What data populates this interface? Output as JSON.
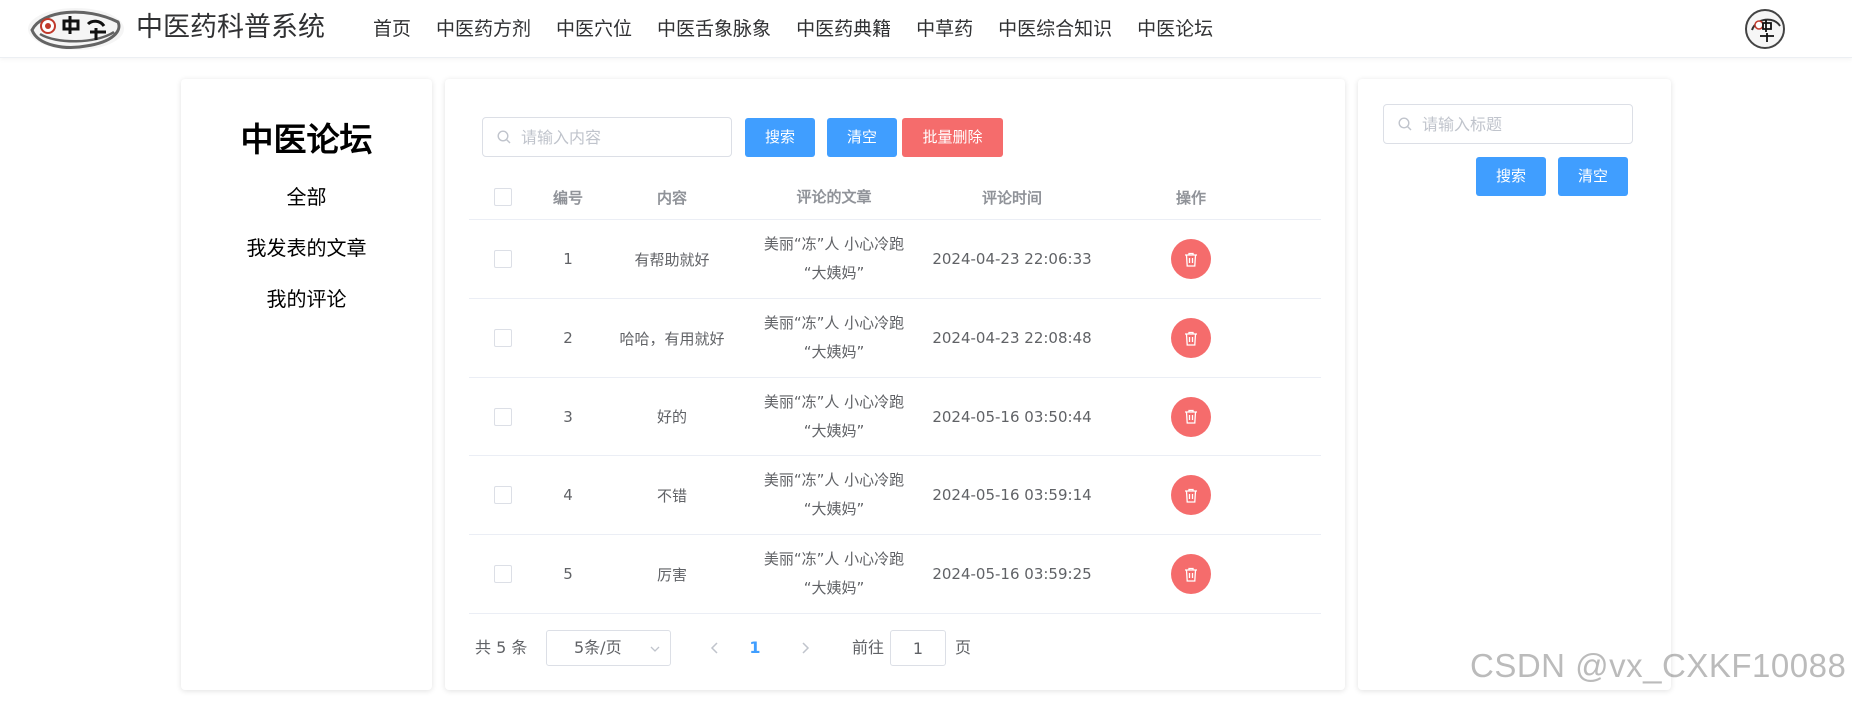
{
  "header": {
    "app_title": "中医药科普系统",
    "nav": [
      "首页",
      "中医药方剂",
      "中医穴位",
      "中医舌象脉象",
      "中医药典籍",
      "中草药",
      "中医综合知识",
      "中医论坛"
    ]
  },
  "sidebar": {
    "title": "中医论坛",
    "links": [
      "全部",
      "我发表的文章",
      "我的评论"
    ]
  },
  "main": {
    "search_placeholder": "请输入内容",
    "search_button": "搜索",
    "clear_button": "清空",
    "batch_delete_button": "批量删除",
    "columns": [
      "编号",
      "内容",
      "评论的文章",
      "评论时间",
      "操作"
    ],
    "rows": [
      {
        "id": "1",
        "content": "有帮助就好",
        "article_line1": "美丽“冻”人 小心冷跑",
        "article_line2": "“大姨妈”",
        "time": "2024-04-23 22:06:33"
      },
      {
        "id": "2",
        "content": "哈哈，有用就好",
        "article_line1": "美丽“冻”人 小心冷跑",
        "article_line2": "“大姨妈”",
        "time": "2024-04-23 22:08:48"
      },
      {
        "id": "3",
        "content": "好的",
        "article_line1": "美丽“冻”人 小心冷跑",
        "article_line2": "“大姨妈”",
        "time": "2024-05-16 03:50:44"
      },
      {
        "id": "4",
        "content": "不错",
        "article_line1": "美丽“冻”人 小心冷跑",
        "article_line2": "“大姨妈”",
        "time": "2024-05-16 03:59:14"
      },
      {
        "id": "5",
        "content": "厉害",
        "article_line1": "美丽“冻”人 小心冷跑",
        "article_line2": "“大姨妈”",
        "time": "2024-05-16 03:59:25"
      }
    ],
    "pager": {
      "total": "共 5 条",
      "page_size": "5条/页",
      "current_page": "1",
      "goto_label": "前往",
      "goto_value": "1",
      "page_label": "页"
    }
  },
  "right_panel": {
    "search_placeholder": "请输入标题",
    "search_button": "搜索",
    "clear_button": "清空"
  },
  "watermark": "CSDN @vx_CXKF10088",
  "colors": {
    "primary": "#409eff",
    "danger": "#f56c6c",
    "border": "#dcdfe6"
  },
  "icons": {
    "logo": "tcm-logo-icon",
    "avatar": "user-avatar-icon",
    "search": "search-icon",
    "delete": "trash-icon",
    "prev": "chevron-left-icon",
    "next": "chevron-right-icon",
    "dropdown": "chevron-down-icon"
  }
}
